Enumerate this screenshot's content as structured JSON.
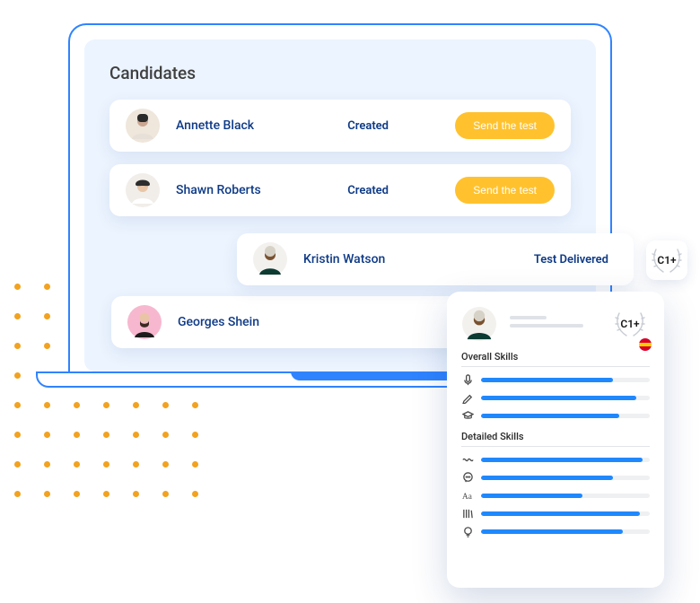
{
  "page_title": "Candidates",
  "score_level": "C1+",
  "send_test_label": "Send the test",
  "status_created": "Created",
  "status_delivered": "Test Delivered",
  "candidates": [
    {
      "name": "Annette Black",
      "status": "Created",
      "action": "send"
    },
    {
      "name": "Shawn Roberts",
      "status": "Created",
      "action": "send"
    },
    {
      "name": "Kristin Watson",
      "status": "Test Delivered",
      "action": "none"
    },
    {
      "name": "Georges Shein",
      "status": "",
      "action": "none"
    }
  ],
  "profile_panel": {
    "score": "C1+",
    "sections": {
      "overall_label": "Overall Skills",
      "detailed_label": "Detailed Skills"
    },
    "overall": [
      {
        "icon": "mic",
        "value": 78
      },
      {
        "icon": "pencil",
        "value": 92
      },
      {
        "icon": "grad",
        "value": 82
      }
    ],
    "detailed": [
      {
        "icon": "wave",
        "value": 96
      },
      {
        "icon": "speech",
        "value": 78
      },
      {
        "icon": "aa",
        "value": 60
      },
      {
        "icon": "books",
        "value": 94
      },
      {
        "icon": "bulb",
        "value": 84
      }
    ]
  },
  "colors": {
    "accent": "#1f88ff",
    "cta": "#ffc22e",
    "dots": "#f2a21f"
  }
}
